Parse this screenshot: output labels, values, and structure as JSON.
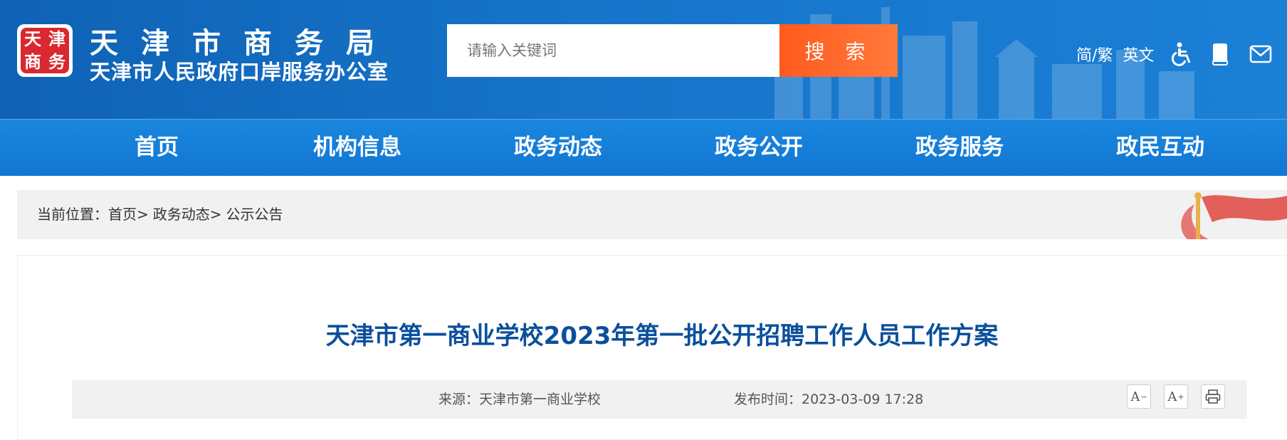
{
  "header": {
    "logo_chars": [
      "天",
      "津",
      "商",
      "务"
    ],
    "title_main": "天津市商务局",
    "title_sub": "天津市人民政府口岸服务办公室",
    "search_placeholder": "请输入关键词",
    "search_button": "搜 索",
    "lang_toggle": "简/繁",
    "english": "英文",
    "icons": [
      "accessibility-icon",
      "book-icon",
      "mail-icon",
      "weibo-icon"
    ]
  },
  "nav": {
    "items": [
      "首页",
      "机构信息",
      "政务动态",
      "政务公开",
      "政务服务",
      "政民互动"
    ]
  },
  "breadcrumb": {
    "prefix": "当前位置：",
    "items": [
      "首页",
      "政务动态",
      "公示公告"
    ],
    "separator": ">"
  },
  "article": {
    "title": "天津市第一商业学校2023年第一批公开招聘工作人员工作方案",
    "source": "来源：天津市第一商业学校",
    "publish_time": "发布时间：2023-03-09 17:28",
    "font_decrease": "A",
    "font_increase": "A"
  },
  "colors": {
    "header_blue": "#1674c9",
    "nav_blue": "#1a86de",
    "search_orange": "#ff5a1e",
    "title_blue": "#0b4f9c",
    "logo_red": "#d9282f"
  }
}
